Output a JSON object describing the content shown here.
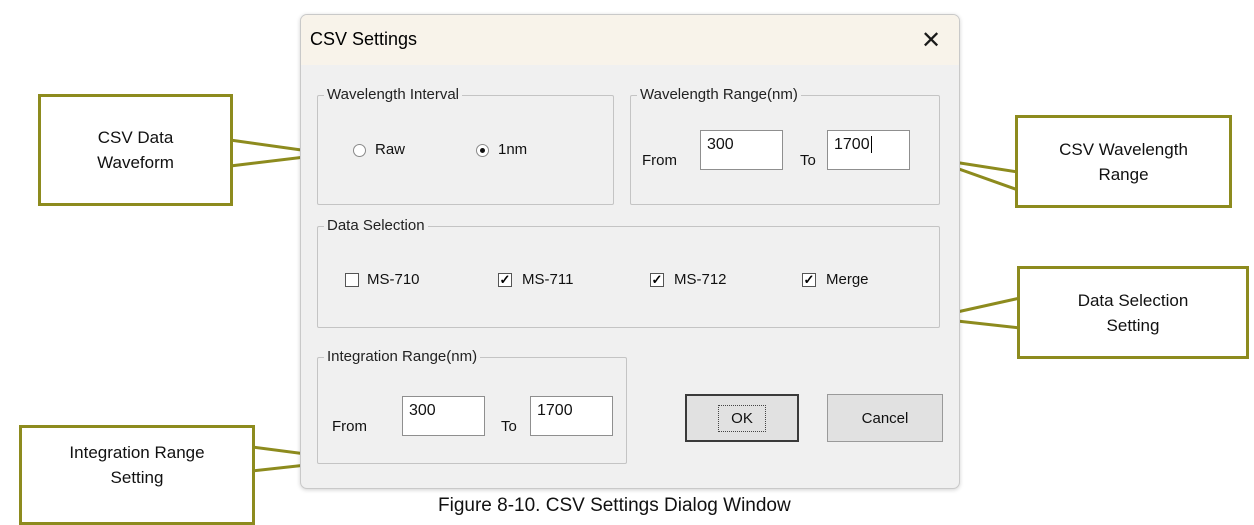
{
  "dialog": {
    "title": "CSV Settings",
    "close_glyph": "✕",
    "wavelength_interval": {
      "legend": "Wavelength Interval",
      "options": [
        {
          "label": "Raw",
          "selected": false
        },
        {
          "label": "1nm",
          "selected": true
        }
      ]
    },
    "wavelength_range": {
      "legend": "Wavelength Range(nm)",
      "from_label": "From",
      "from_value": "300",
      "to_label": "To",
      "to_value": "1700"
    },
    "data_selection": {
      "legend": "Data Selection",
      "items": [
        {
          "label": "MS-710",
          "checked": false
        },
        {
          "label": "MS-711",
          "checked": true
        },
        {
          "label": "MS-712",
          "checked": true
        },
        {
          "label": "Merge",
          "checked": true
        }
      ]
    },
    "integration_range": {
      "legend": "Integration Range(nm)",
      "from_label": "From",
      "from_value": "300",
      "to_label": "To",
      "to_value": "1700"
    },
    "buttons": {
      "ok": "OK",
      "cancel": "Cancel"
    }
  },
  "callouts": {
    "csv_data_waveform": "CSV Data Waveform",
    "csv_wavelength_range": "CSV Wavelength Range",
    "data_selection_setting": "Data Selection Setting",
    "integration_range_setting": "Integration Range Setting"
  },
  "caption": "Figure 8-10. CSV Settings Dialog Window",
  "colors": {
    "callout_border": "#8d8b1e",
    "dialog_bg": "#f0f0f0",
    "titlebar_bg": "#f8f3ea"
  }
}
